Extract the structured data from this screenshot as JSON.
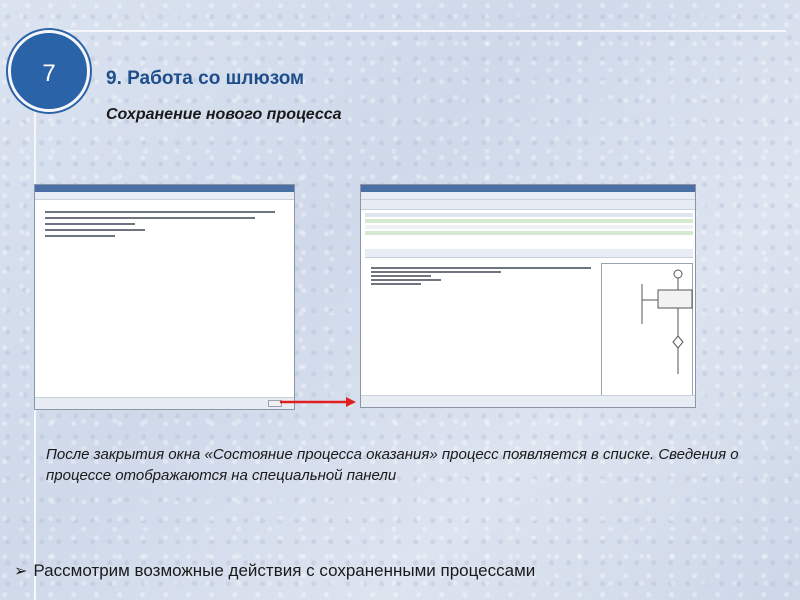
{
  "slide": {
    "number": "7",
    "title": "9. Работа со шлюзом",
    "subtitle": "Сохранение нового процесса",
    "caption": "После закрытия окна «Состояние процесса оказания» процесс появляется в списке. Сведения о процессе отображаются на специальной панели",
    "bullet_text": "Рассмотрим возможные действия с сохраненными процессами",
    "bullet_icon": "arrowhead-bullet-icon"
  },
  "colors": {
    "badge": "#2b63a8",
    "title": "#1f4e8c",
    "arrow": "#e02020"
  }
}
